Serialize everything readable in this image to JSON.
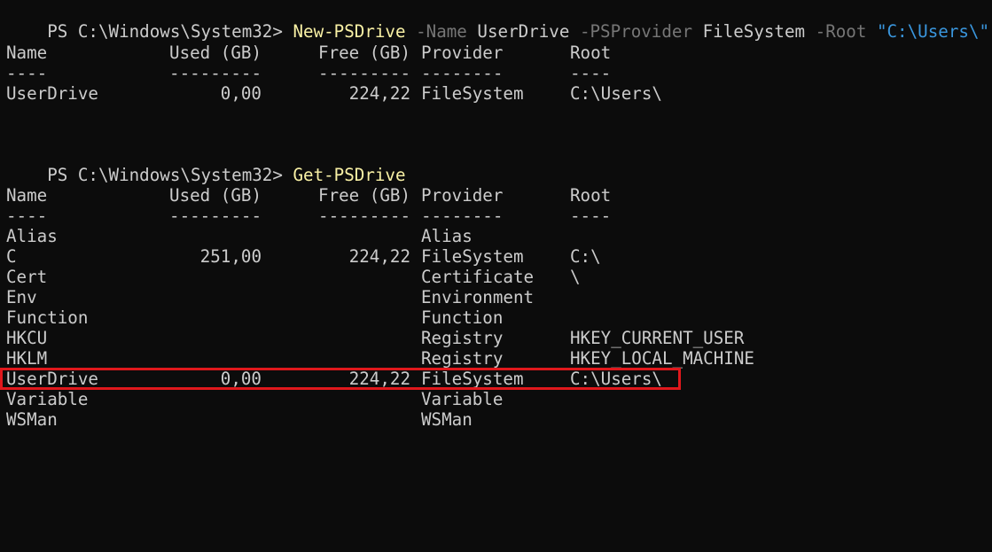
{
  "session1": {
    "prompt": "PS C:\\Windows\\System32> ",
    "command": "New-PSDrive",
    "args": [
      {
        "kind": "param",
        "text": " -Name"
      },
      {
        "kind": "value",
        "text": " UserDrive"
      },
      {
        "kind": "param",
        "text": " -PSProvider"
      },
      {
        "kind": "value",
        "text": " FileSystem"
      },
      {
        "kind": "param",
        "text": " -Root"
      },
      {
        "kind": "string",
        "text": " \"C:\\Users\\\""
      }
    ],
    "columns": [
      "Name",
      "Used (GB)",
      "Free (GB)",
      "Provider",
      "Root"
    ],
    "separators": [
      "----",
      "---------",
      "---------",
      "--------",
      "----"
    ],
    "rows": [
      {
        "name": "UserDrive",
        "used": "0,00",
        "free": "224,22",
        "provider": "FileSystem",
        "root": "C:\\Users\\"
      }
    ]
  },
  "session2": {
    "prompt": "PS C:\\Windows\\System32> ",
    "command": "Get-PSDrive",
    "columns": [
      "Name",
      "Used (GB)",
      "Free (GB)",
      "Provider",
      "Root"
    ],
    "separators": [
      "----",
      "---------",
      "---------",
      "--------",
      "----"
    ],
    "rows": [
      {
        "name": "Alias",
        "used": "",
        "free": "",
        "provider": "Alias",
        "root": ""
      },
      {
        "name": "C",
        "used": "251,00",
        "free": "224,22",
        "provider": "FileSystem",
        "root": "C:\\"
      },
      {
        "name": "Cert",
        "used": "",
        "free": "",
        "provider": "Certificate",
        "root": "\\"
      },
      {
        "name": "Env",
        "used": "",
        "free": "",
        "provider": "Environment",
        "root": ""
      },
      {
        "name": "Function",
        "used": "",
        "free": "",
        "provider": "Function",
        "root": ""
      },
      {
        "name": "HKCU",
        "used": "",
        "free": "",
        "provider": "Registry",
        "root": "HKEY_CURRENT_USER"
      },
      {
        "name": "HKLM",
        "used": "",
        "free": "",
        "provider": "Registry",
        "root": "HKEY_LOCAL_MACHINE"
      },
      {
        "name": "UserDrive",
        "used": "0,00",
        "free": "224,22",
        "provider": "FileSystem",
        "root": "C:\\Users\\",
        "highlighted": true
      },
      {
        "name": "Variable",
        "used": "",
        "free": "",
        "provider": "Variable",
        "root": ""
      },
      {
        "name": "WSMan",
        "used": "",
        "free": "",
        "provider": "WSMan",
        "root": ""
      }
    ]
  },
  "colors": {
    "background": "#0c0c0c",
    "foreground": "#cccccc",
    "command": "#f9f1a5",
    "parameter": "#767676",
    "string": "#3a96dd",
    "highlight_border": "#e0181c"
  }
}
